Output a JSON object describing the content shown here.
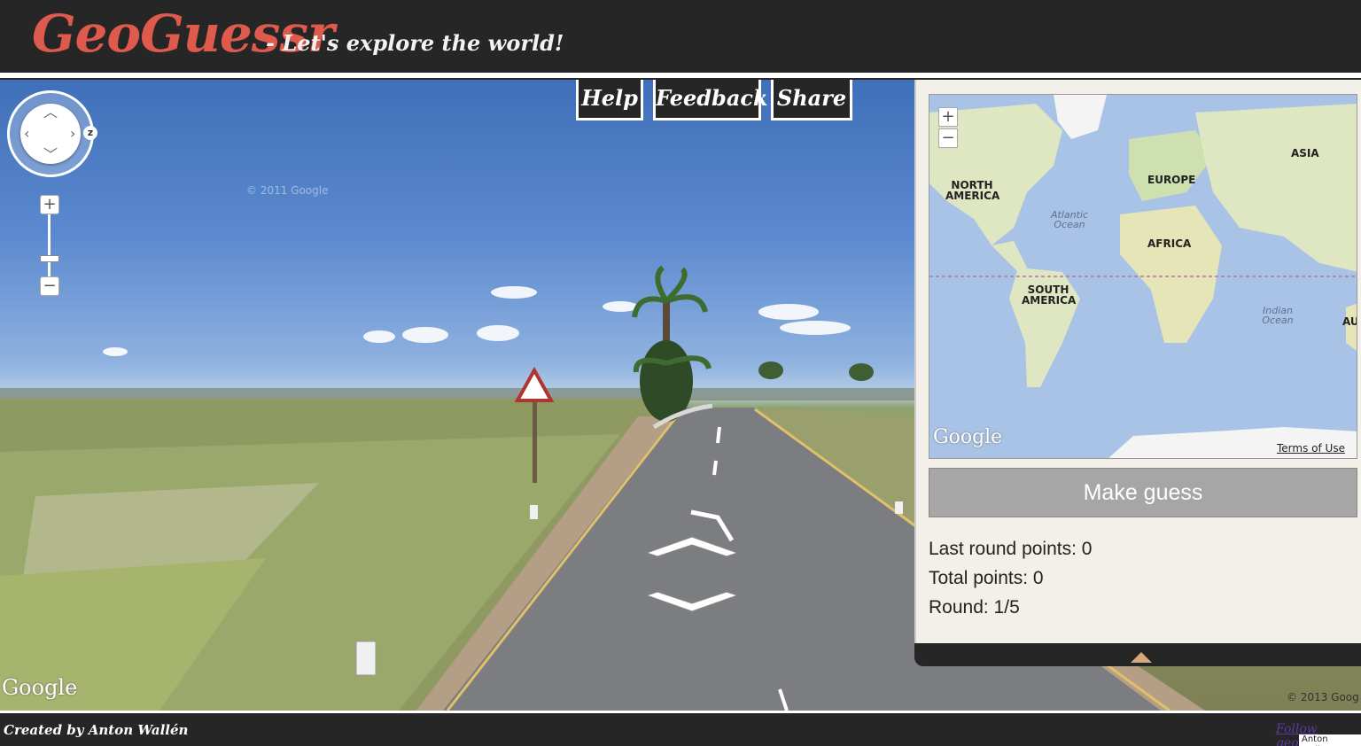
{
  "header": {
    "logo": "GeoGuessr",
    "tagline": "- Let's explore the world!"
  },
  "nav_buttons": [
    {
      "label": "Help"
    },
    {
      "label": "Feedback"
    },
    {
      "label": "Share"
    }
  ],
  "streetview": {
    "watermark": "© 2011 Google",
    "google_logo": "Google",
    "copyright": "© 2013 Goog",
    "pan_control_icons": [
      "arrow-up-icon",
      "arrow-down-icon",
      "arrow-left-icon",
      "arrow-right-icon"
    ],
    "pan_z_label": "z",
    "zoom_in": "+",
    "zoom_out": "−",
    "nav_icons": [
      "chevron-forward-icon",
      "chevron-back-icon"
    ]
  },
  "map": {
    "zoom_in": "+",
    "zoom_out": "−",
    "continents": [
      "NORTH AMERICA",
      "SOUTH AMERICA",
      "EUROPE",
      "AFRICA",
      "ASIA",
      "AU"
    ],
    "oceans": [
      "Atlantic Ocean",
      "Indian Ocean"
    ],
    "google_logo": "Google",
    "terms": "Terms of Use",
    "colors": {
      "water": "#a9c3e6",
      "land": "#dfe7c2"
    }
  },
  "guess": {
    "button_label": "Make guess",
    "last_round_points": "Last round points: 0",
    "total_points": "Total points: 0",
    "round": "Round: 1/5"
  },
  "footer": {
    "credit": "Created by Anton Wallén",
    "follow": "Follow geoguessr",
    "photo_credit": "Anton Wallen"
  },
  "colors": {
    "logo": "#dd5a4c",
    "bar": "#262626",
    "button_grey": "#a6a6a6"
  }
}
